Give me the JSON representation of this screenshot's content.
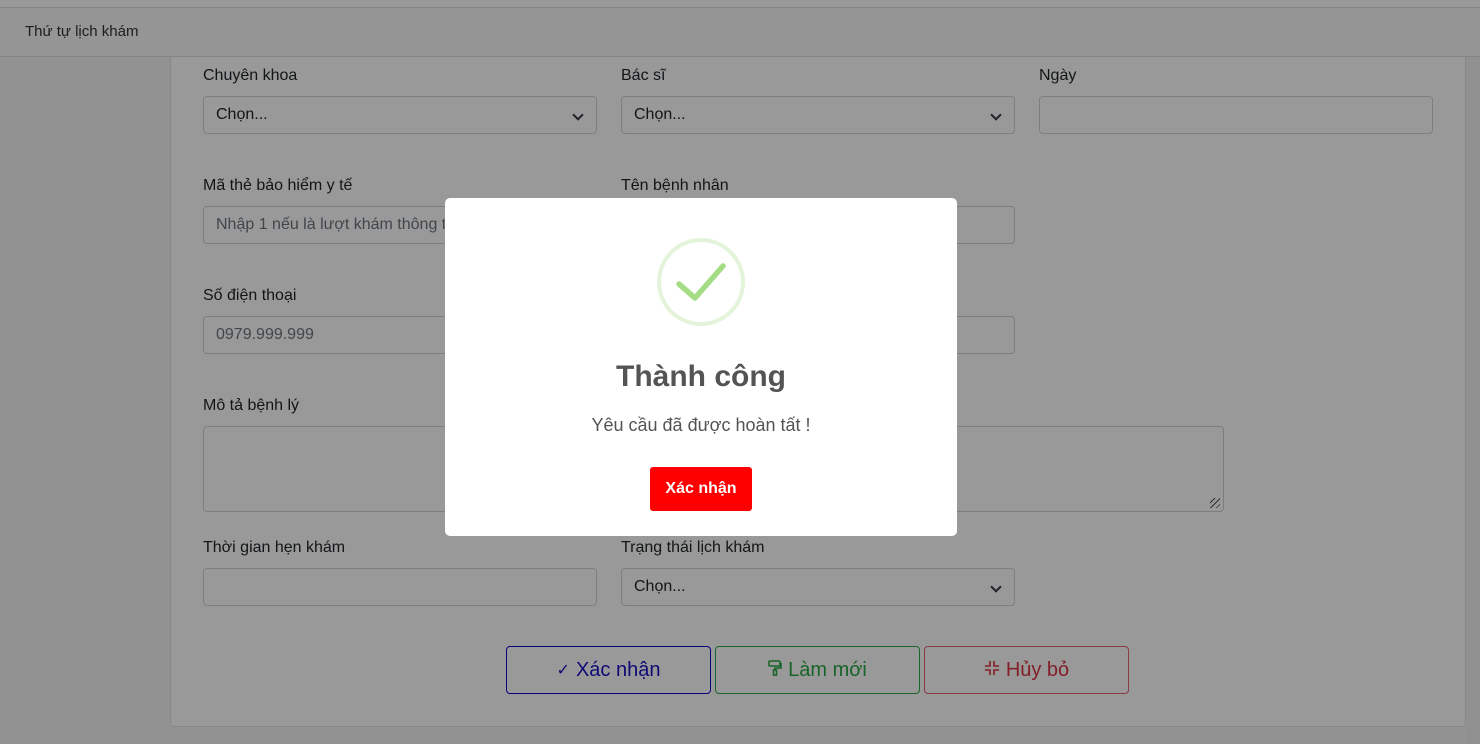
{
  "header": {
    "tab_title": "Thứ tự lịch khám"
  },
  "form": {
    "specialty": {
      "label": "Chuyên khoa",
      "value": "Chọn..."
    },
    "doctor": {
      "label": "Bác sĩ",
      "value": "Chọn..."
    },
    "date": {
      "label": "Ngày",
      "value": ""
    },
    "insurance": {
      "label": "Mã thẻ bảo hiểm y tế",
      "placeholder": "Nhập 1 nếu là lượt khám thông t"
    },
    "patient_name": {
      "label": "Tên bệnh nhân",
      "value": ""
    },
    "phone": {
      "label": "Số điện thoại",
      "placeholder": "0979.999.999"
    },
    "description": {
      "label": "Mô tả bệnh lý",
      "value": ""
    },
    "appointment_time": {
      "label": "Thời gian hẹn khám",
      "value": ""
    },
    "status": {
      "label": "Trạng thái lịch khám",
      "value": "Chọn..."
    }
  },
  "actions": {
    "confirm": {
      "label": "Xác nhận",
      "icon": "check-icon"
    },
    "reset": {
      "label": "Làm mới",
      "icon": "paint-roller-icon"
    },
    "cancel": {
      "label": "Hủy bỏ",
      "icon": "compress-icon"
    }
  },
  "modal": {
    "title": "Thành công",
    "message": "Yêu cầu đã được hoàn tất !",
    "button_label": "Xác nhận",
    "icon": "success-check-icon"
  },
  "colors": {
    "modal_button": "#ff0000",
    "success": "#a5dc86",
    "confirm": "#1a10c4",
    "reset": "#28a745",
    "cancel": "#dc3545"
  }
}
